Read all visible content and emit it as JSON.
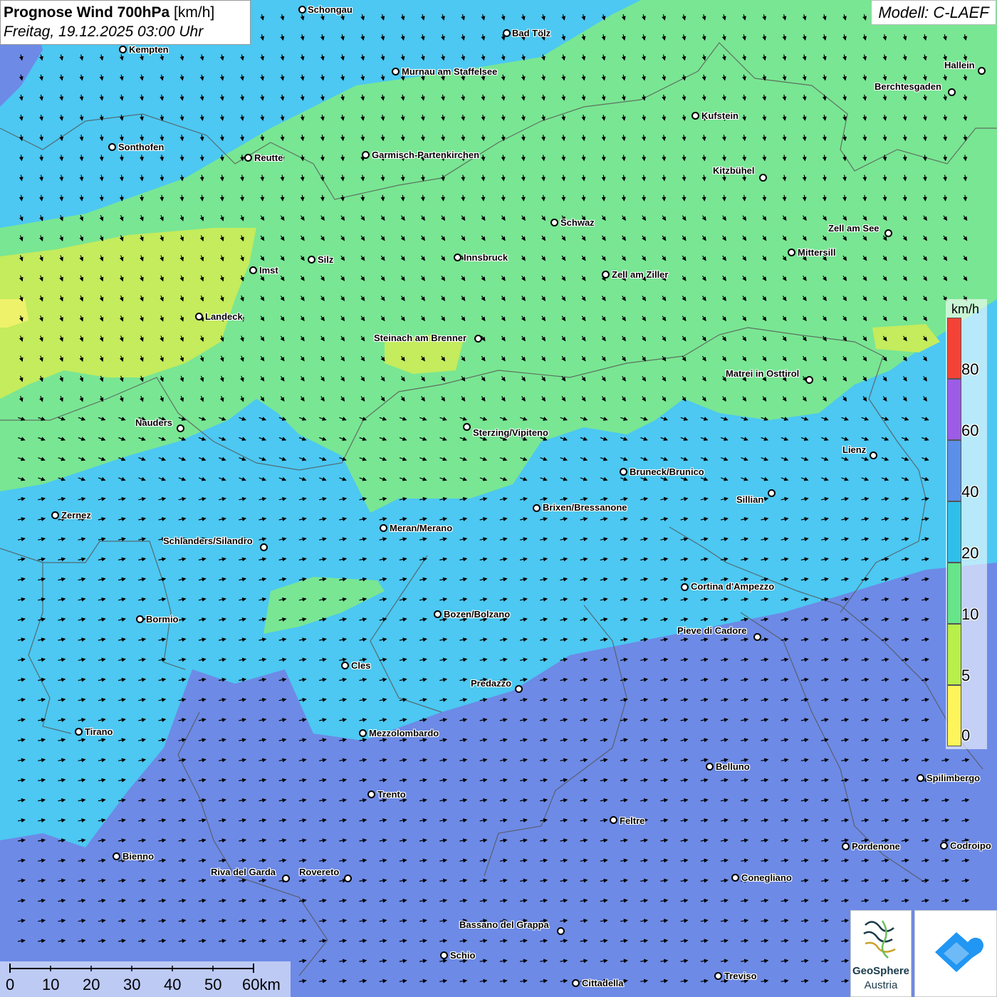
{
  "header": {
    "title_bold": "Prognose Wind 700hPa",
    "title_unit": " [km/h]",
    "datetime": "Freitag, 19.12.2025 03:00 Uhr",
    "model": "Modell: C-LAEF"
  },
  "legend": {
    "unit": "km/h",
    "labels": [
      "80",
      "60",
      "40",
      "20",
      "10",
      "5",
      "0"
    ],
    "colors": [
      "#f44336",
      "#9c5ce6",
      "#5b8fe8",
      "#2ec0ea",
      "#66e58a",
      "#b8ef4a",
      "#fdf55a"
    ]
  },
  "scale_bar": {
    "labels": [
      "0",
      "10",
      "20",
      "30",
      "40",
      "50",
      "60km"
    ]
  },
  "logos": {
    "geosphere_line1": "GeoSphere",
    "geosphere_line2": "Austria"
  },
  "cities": [
    {
      "name": "Schongau"
    },
    {
      "name": "Bad Tölz"
    },
    {
      "name": "Kempten"
    },
    {
      "name": "Murnau am Staffelsee"
    },
    {
      "name": "Hallein"
    },
    {
      "name": "Berchtesgaden"
    },
    {
      "name": "Kufstein"
    },
    {
      "name": "Sonthofen"
    },
    {
      "name": "Reutte"
    },
    {
      "name": "Garmisch-Partenkirchen"
    },
    {
      "name": "Kitzbühel"
    },
    {
      "name": "Schwaz"
    },
    {
      "name": "Zell am See"
    },
    {
      "name": "Innsbruck"
    },
    {
      "name": "Mittersill"
    },
    {
      "name": "Silz"
    },
    {
      "name": "Imst"
    },
    {
      "name": "Zell am Ziller"
    },
    {
      "name": "Landeck"
    },
    {
      "name": "Steinach am Brenner"
    },
    {
      "name": "Matrei in Osttirol"
    },
    {
      "name": "Nauders"
    },
    {
      "name": "Sterzing/Vipiteno"
    },
    {
      "name": "Lienz"
    },
    {
      "name": "Bruneck/Brunico"
    },
    {
      "name": "Sillian"
    },
    {
      "name": "Brixen/Bressanone"
    },
    {
      "name": "Zernez"
    },
    {
      "name": "Meran/Merano"
    },
    {
      "name": "Schlanders/Silandro"
    },
    {
      "name": "Cortina d'Ampezzo"
    },
    {
      "name": "Bozen/Bolzano"
    },
    {
      "name": "Bormio"
    },
    {
      "name": "Pieve di Cadore"
    },
    {
      "name": "Cles"
    },
    {
      "name": "Predazzo"
    },
    {
      "name": "Tirano"
    },
    {
      "name": "Mezzolombardo"
    },
    {
      "name": "Belluno"
    },
    {
      "name": "Spilimbergo"
    },
    {
      "name": "Trento"
    },
    {
      "name": "Feltre"
    },
    {
      "name": "Pordenone"
    },
    {
      "name": "Codroipo"
    },
    {
      "name": "Bienno"
    },
    {
      "name": "Riva del Garda"
    },
    {
      "name": "Rovereto"
    },
    {
      "name": "Conegliano"
    },
    {
      "name": "Bassano del Grappa"
    },
    {
      "name": "Schio"
    },
    {
      "name": "Treviso"
    },
    {
      "name": "Cittadella"
    }
  ]
}
